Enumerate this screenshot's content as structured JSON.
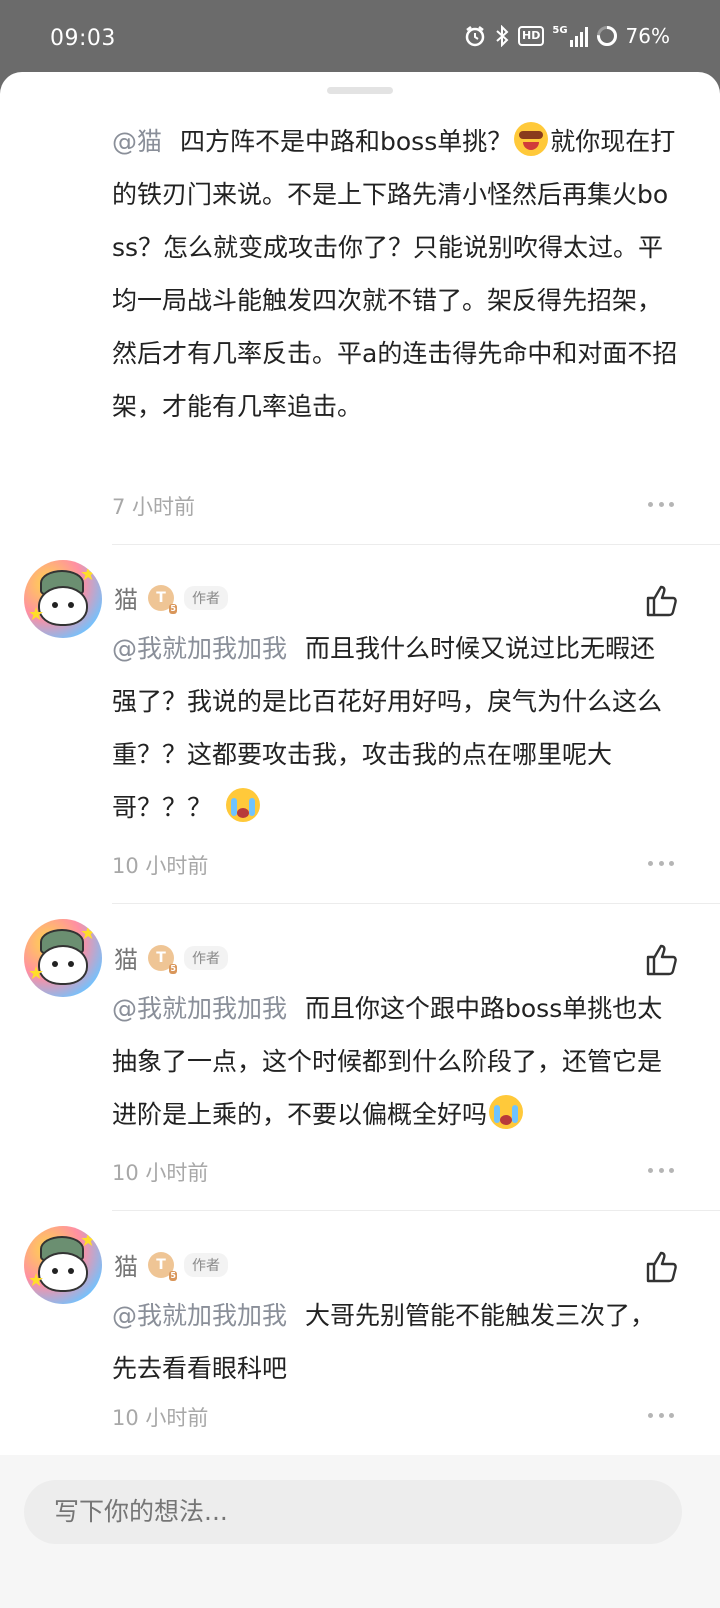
{
  "status_bar": {
    "time": "09:03",
    "network": "5G",
    "hd": "HD",
    "battery": "76%"
  },
  "comments": [
    {
      "mention": "@猫",
      "text_a": "四方阵不是中路和boss单挑？",
      "emoji_a": "grinning-face-emoji",
      "text_b": "就你现在打的铁刃门来说。不是上下路先清小怪然后再集火boss？怎么就变成攻击你了？只能说别吹得太过。平均一局战斗能触发四次就不错了。架反得先招架，然后才有几率反击。平a的连击得先命中和对面不招架，才能有几率追击。",
      "time": "7 小时前"
    },
    {
      "author": "猫",
      "level": "T",
      "level_sub": "5",
      "tag": "作者",
      "mention": "@我就加我加我",
      "text": "而且我什么时候又说过比无暇还强了？我说的是比百花好用好吗，戾气为什么这么重？？这都要攻击我，攻击我的点在哪里呢大哥？？？",
      "emoji": "crying-face-emoji",
      "time": "10 小时前"
    },
    {
      "author": "猫",
      "level": "T",
      "level_sub": "5",
      "tag": "作者",
      "mention": "@我就加我加我",
      "text": "而且你这个跟中路boss单挑也太抽象了一点，这个时候都到什么阶段了，还管它是进阶是上乘的，不要以偏概全好吗",
      "emoji": "crying-face-emoji",
      "time": "10 小时前"
    },
    {
      "author": "猫",
      "level": "T",
      "level_sub": "5",
      "tag": "作者",
      "mention": "@我就加我加我",
      "text": "大哥先别管能不能触发三次了，先去看看眼科吧",
      "time": "10 小时前"
    }
  ],
  "input": {
    "placeholder": "写下你的想法..."
  },
  "colors": {
    "status_bg": "#6b6b6b",
    "mention": "#8a8f99",
    "text": "#222222",
    "meta": "#a8a8a8"
  }
}
